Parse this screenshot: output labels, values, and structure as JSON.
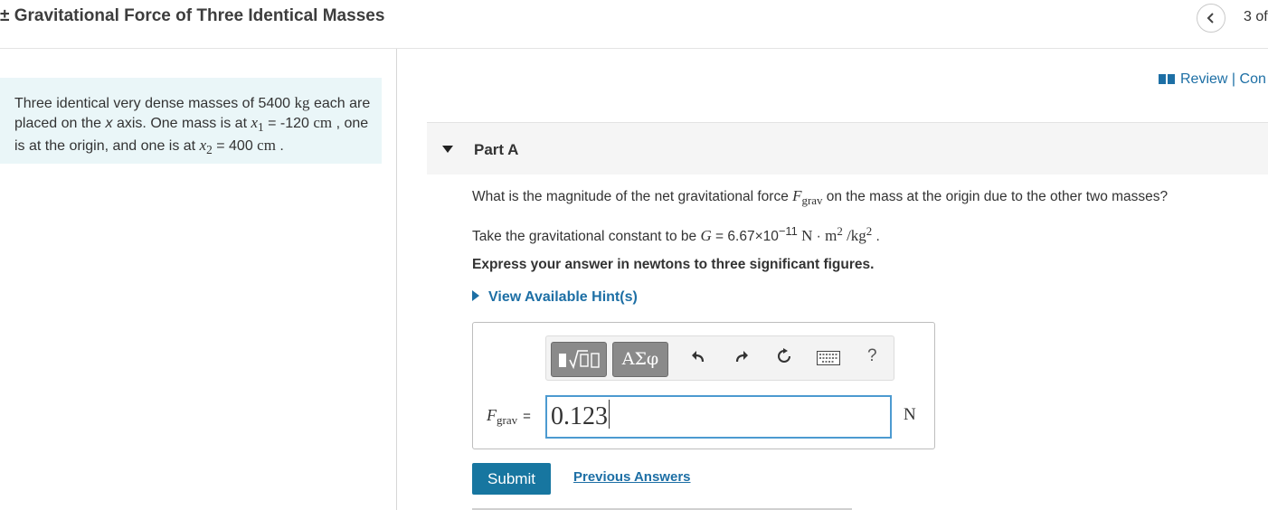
{
  "header": {
    "title": "± Gravitational Force of Three Identical Masses",
    "counter": "3 of"
  },
  "problem": {
    "t1": "Three identical very dense masses of 5400 ",
    "kg": "kg",
    "t2": " each are placed on the ",
    "x": "x",
    "t3": " axis. One mass is at ",
    "x1": "x",
    "x1_sub": "1",
    "t4": " = -120 ",
    "cm1": "cm",
    "t5": " , one is at the origin, and one is at ",
    "x2": "x",
    "x2_sub": "2",
    "t6": " = 400 ",
    "cm2": "cm",
    "t7": " ."
  },
  "review": {
    "label": "Review | Con"
  },
  "part": {
    "title": "Part A"
  },
  "question": {
    "q1_a": "What is the magnitude of the net gravitational force ",
    "F": "F",
    "grav": "grav",
    "q1_b": " on the mass at the origin due to the other two masses?",
    "q2_a": "Take the gravitational constant to be ",
    "G": "G",
    "q2_b": " = 6.67×10",
    "exp": "−11",
    "units_N": " N",
    "dot": " · ",
    "m": "m",
    "sq1": "2",
    "slash": " /kg",
    "sq2": "2",
    "q2_end": " .",
    "q3": "Express your answer in newtons to three significant figures."
  },
  "hint": {
    "label": "View Available Hint(s)"
  },
  "toolbar": {
    "symbols_label": "ΑΣφ",
    "help_label": "?"
  },
  "answer": {
    "label_var": "F",
    "label_sub": "grav",
    "label_eq": "=",
    "value": "0.123",
    "unit": "N"
  },
  "actions": {
    "submit_label": "Submit",
    "previous_answers_label": "Previous Answers"
  },
  "colors": {
    "accent": "#1d6fa5",
    "submit": "#1776a0",
    "problem_bg": "#eaf6f8"
  },
  "icons": [
    "chevron-left-icon",
    "book-icon",
    "caret-down-icon",
    "caret-right-icon",
    "templates-icon",
    "undo-icon",
    "redo-icon",
    "reset-icon",
    "keyboard-icon"
  ]
}
